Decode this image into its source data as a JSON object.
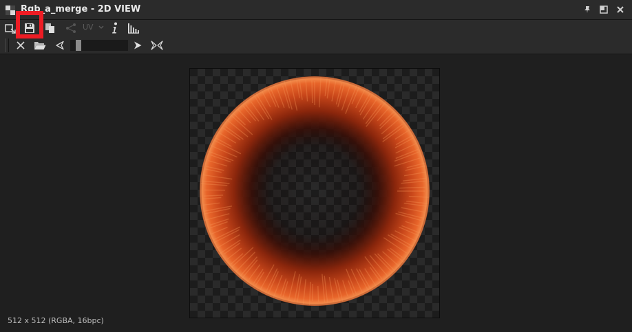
{
  "window": {
    "title": "Rgb_a_merge - 2D VIEW"
  },
  "titlebar": {
    "controls": [
      {
        "name": "pin-icon"
      },
      {
        "name": "float-window-icon"
      },
      {
        "name": "close-icon"
      }
    ]
  },
  "toolbar1": {
    "uv_label": "UV",
    "items": [
      {
        "name": "export-view-icon"
      },
      {
        "name": "save-icon"
      },
      {
        "name": "copy-icon"
      },
      {
        "name": "share-nodes-icon"
      },
      {
        "name": "uv-dropdown"
      },
      {
        "name": "info-icon"
      },
      {
        "name": "histogram-icon"
      }
    ]
  },
  "toolbar2": {
    "items": [
      {
        "name": "clear-icon"
      },
      {
        "name": "open-folder-icon"
      },
      {
        "name": "previous-icon"
      },
      {
        "name": "frame-slider"
      },
      {
        "name": "next-icon"
      },
      {
        "name": "fit-view-icon"
      }
    ],
    "slider_level": 0.1
  },
  "viewport": {
    "image_info": "512 x 512 (RGBA, 16bpc)"
  },
  "colors": {
    "highlight": "#ee1c24",
    "ring_bright": "#e8652a",
    "ring_dark": "#5a1508"
  }
}
